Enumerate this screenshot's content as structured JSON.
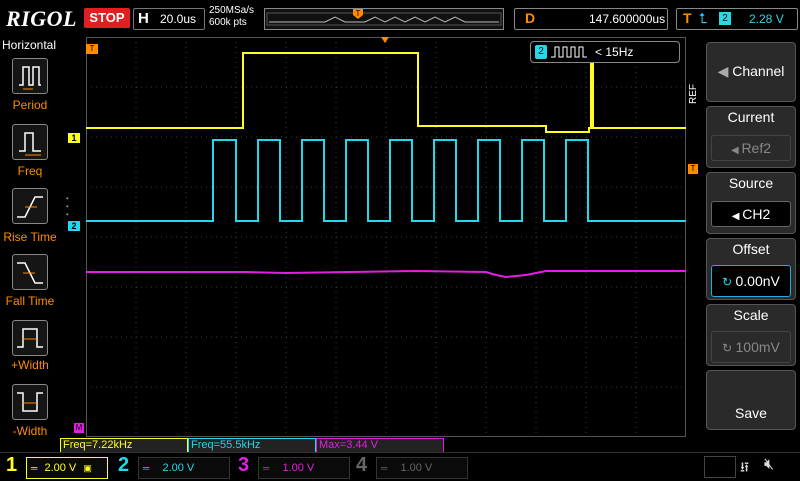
{
  "topbar": {
    "logo": "RIGOL",
    "run_state": "STOP",
    "horizontal_label": "H",
    "timebase": "20.0us",
    "sample_rate": "250MSa/s",
    "memory_depth": "600k pts",
    "trigger_position_marker": "T",
    "delay_label": "D",
    "delay_value": "147.600000us",
    "trigger_label": "T",
    "trigger_channel": "2",
    "trigger_level": "2.28 V"
  },
  "left_panel": {
    "title": "Horizontal",
    "items": [
      {
        "label": "Period",
        "icon": "period-icon"
      },
      {
        "label": "Freq",
        "icon": "frequency-icon"
      },
      {
        "label": "Rise Time",
        "icon": "rise-time-icon"
      },
      {
        "label": "Fall Time",
        "icon": "fall-time-icon"
      },
      {
        "label": "+Width",
        "icon": "positive-width-icon"
      },
      {
        "label": "-Width",
        "icon": "negative-width-icon"
      }
    ]
  },
  "screen": {
    "ref_tab": "REF",
    "ref_popup_channel": "2",
    "ref_popup_text": "< 15Hz",
    "markers": {
      "ch1": "1",
      "ch2": "2",
      "math": "M",
      "trigger_level": "T"
    },
    "colors": {
      "ch1": "#ffff20",
      "ch2": "#22d8ea",
      "math": "#e020e0",
      "trigger": "#ff8c00",
      "grid": "#444444"
    }
  },
  "right_menu": {
    "items": [
      {
        "title": "Channel",
        "value": ""
      },
      {
        "title": "Current",
        "value": "Ref2"
      },
      {
        "title": "Source",
        "value": "CH2"
      },
      {
        "title": "Offset",
        "value": "0.00nV"
      },
      {
        "title": "Scale",
        "value": "100mV"
      },
      {
        "title": "Save",
        "value": ""
      }
    ]
  },
  "measurements": [
    {
      "text": "Freq=7.22kHz",
      "color": "#ffff20"
    },
    {
      "text": "Freq=55.5kHz",
      "color": "#22d8ea"
    },
    {
      "text": "Max=3.44 V",
      "color": "#e020e0"
    }
  ],
  "channels": [
    {
      "num": "1",
      "scale": "2.00 V",
      "color": "#ffff20"
    },
    {
      "num": "2",
      "scale": "2.00 V",
      "color": "#22d8ea"
    },
    {
      "num": "3",
      "scale": "1.00 V",
      "color": "#e020e0"
    },
    {
      "num": "4",
      "scale": "1.00 V",
      "color": "#666666"
    }
  ]
}
